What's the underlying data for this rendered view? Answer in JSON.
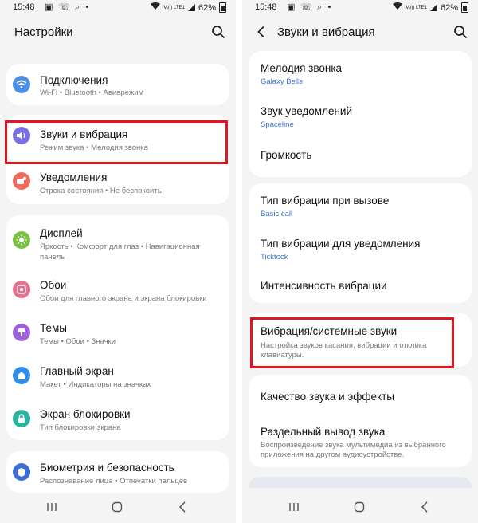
{
  "left": {
    "status": {
      "time": "15:48",
      "battery": "62%",
      "volte": "Vo)) LTE1"
    },
    "title": "Настройки",
    "items": [
      {
        "title": "Подключения",
        "subtitle": "Wi-Fi  •  Bluetooth  •  Авиарежим",
        "icon": "wifi-icon",
        "color": "#4a8fe7"
      },
      {
        "title": "Звуки и вибрация",
        "subtitle": "Режим звука  •  Мелодия звонка",
        "icon": "sound-icon",
        "color": "#7b70e3"
      },
      {
        "title": "Уведомления",
        "subtitle": "Строка состояния  •  Не беспокоить",
        "icon": "notifications-icon",
        "color": "#f26a5a"
      },
      {
        "title": "Дисплей",
        "subtitle1": "Яркость  •  Комфорт для глаз  •  Навигационная",
        "subtitle2": "панель",
        "icon": "display-icon",
        "color": "#7bc043"
      },
      {
        "title": "Обои",
        "subtitle": "Обои для главного экрана и экрана блокировки",
        "icon": "wallpaper-icon",
        "color": "#ef6d8d"
      },
      {
        "title": "Темы",
        "subtitle": "Темы  •  Обои  •  Значки",
        "icon": "themes-icon",
        "color": "#a062d9"
      },
      {
        "title": "Главный экран",
        "subtitle": "Макет  •  Индикаторы на значках",
        "icon": "home-icon",
        "color": "#2f8eea"
      },
      {
        "title": "Экран блокировки",
        "subtitle": "Тип блокировки экрана",
        "icon": "lock-icon",
        "color": "#2bb3a0"
      },
      {
        "title": "Биометрия и безопасность",
        "subtitle": "Распознавание лица  •  Отпечатки пальцев",
        "icon": "shield-icon",
        "color": "#3d6fd9"
      }
    ]
  },
  "right": {
    "status": {
      "time": "15:48",
      "battery": "62%",
      "volte": "Vo)) LTE1"
    },
    "title": "Звуки и вибрация",
    "items": [
      {
        "title": "Мелодия звонка",
        "value": "Galaxy Bells"
      },
      {
        "title": "Звук уведомлений",
        "value": "Spaceline"
      },
      {
        "title": "Громкость"
      },
      {
        "title": "Тип вибрации при вызове",
        "value": "Basic call"
      },
      {
        "title": "Тип вибрации для уведомления",
        "value": "Ticktock"
      },
      {
        "title": "Интенсивность вибрации"
      },
      {
        "title": "Вибрация/системные звуки",
        "subtitle1": "Настройка звуков касания, вибрации и отклика",
        "subtitle2": "клавиатуры."
      },
      {
        "title": "Качество звука и эффекты"
      },
      {
        "title": "Раздельный вывод звука",
        "subtitle1": "Воспроизведение звука мультимедиа из выбранного",
        "subtitle2": "приложения на другом аудиоустройстве."
      }
    ]
  },
  "colors": {
    "highlight": "#e1141f",
    "accent_blue": "#3a72c8"
  }
}
